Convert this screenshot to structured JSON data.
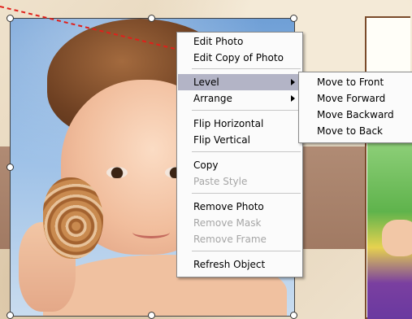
{
  "context_menu": {
    "items": [
      {
        "label": "Edit Photo",
        "enabled": true
      },
      {
        "label": "Edit Copy of Photo",
        "enabled": true
      },
      {
        "label": "Level",
        "enabled": true,
        "highlighted": true,
        "has_submenu": true
      },
      {
        "label": "Arrange",
        "enabled": true,
        "has_submenu": true
      },
      {
        "label": "Flip Horizontal",
        "enabled": true
      },
      {
        "label": "Flip Vertical",
        "enabled": true
      },
      {
        "label": "Copy",
        "enabled": true
      },
      {
        "label": "Paste Style",
        "enabled": false
      },
      {
        "label": "Remove Photo",
        "enabled": true
      },
      {
        "label": "Remove Mask",
        "enabled": false
      },
      {
        "label": "Remove Frame",
        "enabled": false
      },
      {
        "label": "Refresh Object",
        "enabled": true
      }
    ]
  },
  "level_submenu": {
    "items": [
      {
        "label": "Move to Front"
      },
      {
        "label": "Move Forward"
      },
      {
        "label": "Move Backward"
      },
      {
        "label": "Move to Back"
      }
    ]
  },
  "colors": {
    "menu_highlight": "#b3b4c6",
    "disabled_text": "#a6a6a6",
    "annotation_arrow": "#e0201b"
  }
}
